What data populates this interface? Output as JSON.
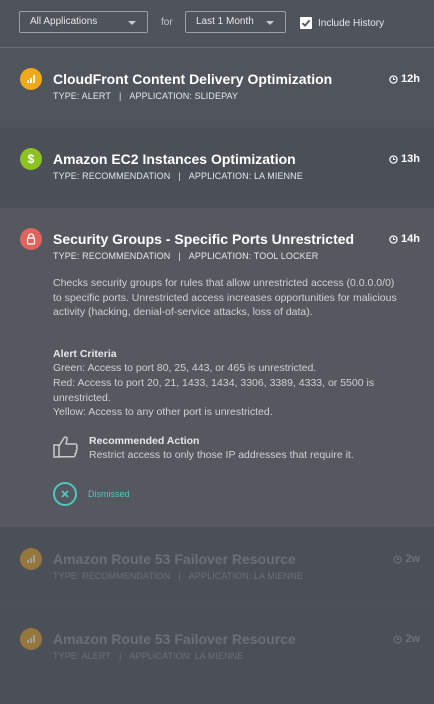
{
  "filters": {
    "application": "All Applications",
    "for_label": "for",
    "period": "Last 1 Month",
    "include_history_label": "Include History",
    "include_history_checked": true
  },
  "colors": {
    "alert_orange": "#f0a81c",
    "recommendation_green": "#8dc21f",
    "security_red": "#e0645c",
    "dismiss_teal": "#4ec7c2"
  },
  "items": [
    {
      "icon": "signal-bars-icon",
      "title": "CloudFront Content Delivery Optimization",
      "type_text": "TYPE: ALERT",
      "app_text": "APPLICATION: SLIDEPAY",
      "separator": "|",
      "time": "12h"
    },
    {
      "icon": "dollar-icon",
      "title": "Amazon EC2 Instances Optimization",
      "type_text": "TYPE: RECOMMENDATION",
      "app_text": "APPLICATION: LA MIENNE",
      "separator": "|",
      "time": "13h"
    },
    {
      "icon": "lock-icon",
      "title": "Security Groups - Specific Ports Unrestricted",
      "type_text": "TYPE: RECOMMENDATION",
      "app_text": "APPLICATION: TOOL LOCKER",
      "separator": "|",
      "time": "14h",
      "description": "Checks security groups for rules that allow unrestricted access (0.0.0.0/0) to specific ports. Unrestricted access increases opportunities for malicious activity (hacking, denial-of-service attacks, loss of data).",
      "criteria_title": "Alert Criteria",
      "criteria": [
        "Green: Access to port 80, 25, 443, or 465 is unrestricted.",
        "Red: Access to port 20, 21, 1433, 1434, 3306, 3389, 4333, or 5500 is unrestricted.",
        "Yellow: Access to any other port is unrestricted."
      ],
      "recommended_action_title": "Recommended Action",
      "recommended_action_text": "Restrict access to only those IP addresses that require it.",
      "status_label": "Dismissed"
    },
    {
      "icon": "signal-bars-icon",
      "title": "Amazon Route 53 Failover Resource",
      "type_text": "TYPE: RECOMMENDATION",
      "app_text": "APPLICATION: LA MIENNE",
      "separator": "|",
      "time": "2w"
    },
    {
      "icon": "signal-bars-icon",
      "title": "Amazon Route 53 Failover Resource",
      "type_text": "TYPE: ALERT",
      "app_text": "APPLICATION: LA MIENNE",
      "separator": "|",
      "time": "2w"
    }
  ]
}
